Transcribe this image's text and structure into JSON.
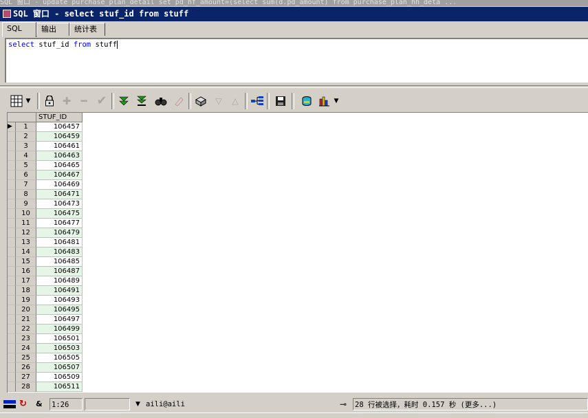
{
  "background_window": {
    "title": "SQL 窗口 - update purchase_plan_detail set pd_hf_amount=(select sum(d.pd_amount) from purchase_plan_hh_deta ..."
  },
  "window": {
    "title": "SQL 窗口 - select stuf_id from stuff"
  },
  "tabs": [
    {
      "label": "SQL",
      "active": true
    },
    {
      "label": "输出",
      "active": false
    },
    {
      "label": "统计表",
      "active": false
    }
  ],
  "editor": {
    "query_keyword_select": "select",
    "query_column": " stuf_id ",
    "query_keyword_from": "from",
    "query_table": " stuff"
  },
  "toolbar": {
    "icons": [
      "grid-view-icon",
      "dropdown-arrow-icon",
      "lock-icon",
      "add-record-icon",
      "delete-record-icon",
      "post-changes-icon",
      "fetch-next-icon",
      "fetch-last-icon",
      "find-icon",
      "clear-icon",
      "query-by-example-icon",
      "previous-record-icon",
      "next-record-icon",
      "single-record-view-icon",
      "save-icon",
      "export-icon",
      "chart-icon",
      "dropdown-arrow-icon"
    ]
  },
  "grid": {
    "column_header": "STUF_ID",
    "current_row_marker": "▶",
    "rows": [
      {
        "n": "1",
        "stuf_id": "106457"
      },
      {
        "n": "2",
        "stuf_id": "106459"
      },
      {
        "n": "3",
        "stuf_id": "106461"
      },
      {
        "n": "4",
        "stuf_id": "106463"
      },
      {
        "n": "5",
        "stuf_id": "106465"
      },
      {
        "n": "6",
        "stuf_id": "106467"
      },
      {
        "n": "7",
        "stuf_id": "106469"
      },
      {
        "n": "8",
        "stuf_id": "106471"
      },
      {
        "n": "9",
        "stuf_id": "106473"
      },
      {
        "n": "10",
        "stuf_id": "106475"
      },
      {
        "n": "11",
        "stuf_id": "106477"
      },
      {
        "n": "12",
        "stuf_id": "106479"
      },
      {
        "n": "13",
        "stuf_id": "106481"
      },
      {
        "n": "14",
        "stuf_id": "106483"
      },
      {
        "n": "15",
        "stuf_id": "106485"
      },
      {
        "n": "16",
        "stuf_id": "106487"
      },
      {
        "n": "17",
        "stuf_id": "106489"
      },
      {
        "n": "18",
        "stuf_id": "106491"
      },
      {
        "n": "19",
        "stuf_id": "106493"
      },
      {
        "n": "20",
        "stuf_id": "106495"
      },
      {
        "n": "21",
        "stuf_id": "106497"
      },
      {
        "n": "22",
        "stuf_id": "106499"
      },
      {
        "n": "23",
        "stuf_id": "106501"
      },
      {
        "n": "24",
        "stuf_id": "106503"
      },
      {
        "n": "25",
        "stuf_id": "106505"
      },
      {
        "n": "26",
        "stuf_id": "106507"
      },
      {
        "n": "27",
        "stuf_id": "106509"
      },
      {
        "n": "28",
        "stuf_id": "106511"
      }
    ]
  },
  "status": {
    "amp": "&",
    "cursor_position": "1:26",
    "connection": "aili@aili",
    "message": "28 行被选择，耗时 0.157 秒 (更多...)"
  },
  "colors": {
    "title_bar": "#0a246a",
    "alt_row": "#e6f6e6",
    "keyword": "#0000ff"
  }
}
